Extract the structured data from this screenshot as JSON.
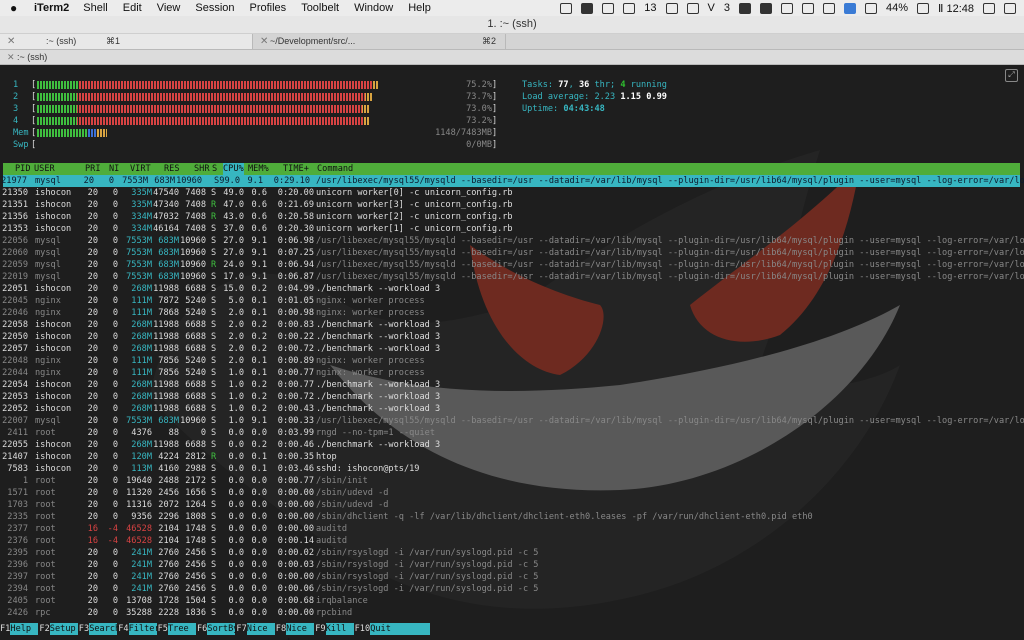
{
  "menubar": {
    "app": "iTerm2",
    "items": [
      "Shell",
      "Edit",
      "View",
      "Session",
      "Profiles",
      "Toolbelt",
      "Window",
      "Help"
    ],
    "status": {
      "badge": "13",
      "letter_v": "V",
      "number": "3",
      "battery": "44%",
      "clock": "Ⅱ 12:48"
    }
  },
  "window": {
    "title": "1. :~ (ssh)"
  },
  "tabs": [
    {
      "label": ":~ (ssh)",
      "shortcut": "⌘1"
    },
    {
      "label": "~/Development/src/...",
      "shortcut": "⌘2"
    }
  ],
  "subtab": {
    "label": ":~ (ssh)"
  },
  "meters": {
    "cpus": [
      {
        "id": "1",
        "pct": "75.2%",
        "fill": 0.752
      },
      {
        "id": "2",
        "pct": "73.7%",
        "fill": 0.737
      },
      {
        "id": "3",
        "pct": "73.0%",
        "fill": 0.73
      },
      {
        "id": "4",
        "pct": "73.2%",
        "fill": 0.732
      }
    ],
    "mem": {
      "label": "Mem",
      "value": "1148/7483MB",
      "fill": 0.153
    },
    "swp": {
      "label": "Swp",
      "value": "0/0MB",
      "fill": 0
    }
  },
  "info": {
    "tasks_label": "Tasks: ",
    "tasks": "77",
    "thr_sep": ", ",
    "thr": "36",
    "thr_label": " thr; ",
    "running": "4",
    "running_label": " running",
    "load_label": "Load average: ",
    "load1": "2.23",
    "load5": "1.15",
    "load15": "0.99",
    "uptime_label": "Uptime: ",
    "uptime": "04:43:48"
  },
  "columns": {
    "pid": "PID",
    "user": "USER",
    "pri": "PRI",
    "ni": "NI",
    "virt": "VIRT",
    "res": "RES",
    "shr": "SHR",
    "s": "S",
    "cpu": "CPU%",
    "mem": "MEM%",
    "time": "TIME+",
    "cmd": "Command"
  },
  "processes": [
    [
      "21977",
      "mysql",
      "20",
      "0",
      "7553M",
      "683M",
      "10960",
      "S",
      "99.0",
      "9.1",
      "0:29.10",
      "/usr/libexec/mysql55/mysqld --basedir=/usr --datadir=/var/lib/mysql --plugin-dir=/usr/lib64/mysql/plugin --user=mysql --log-error=/var/log/my"
    ],
    [
      "21350",
      "ishocon",
      "20",
      "0",
      "335M",
      "47540",
      "7408",
      "S",
      "49.0",
      "0.6",
      "0:20.00",
      "unicorn worker[0] -c unicorn_config.rb"
    ],
    [
      "21351",
      "ishocon",
      "20",
      "0",
      "335M",
      "47340",
      "7408",
      "R",
      "47.0",
      "0.6",
      "0:21.69",
      "unicorn worker[3] -c unicorn_config.rb"
    ],
    [
      "21356",
      "ishocon",
      "20",
      "0",
      "334M",
      "47032",
      "7408",
      "R",
      "43.0",
      "0.6",
      "0:20.58",
      "unicorn worker[2] -c unicorn_config.rb"
    ],
    [
      "21353",
      "ishocon",
      "20",
      "0",
      "334M",
      "46164",
      "7408",
      "S",
      "37.0",
      "0.6",
      "0:20.30",
      "unicorn worker[1] -c unicorn_config.rb"
    ],
    [
      "22056",
      "mysql",
      "20",
      "0",
      "7553M",
      "683M",
      "10960",
      "S",
      "27.0",
      "9.1",
      "0:06.98",
      "/usr/libexec/mysql55/mysqld --basedir=/usr --datadir=/var/lib/mysql --plugin-dir=/usr/lib64/mysql/plugin --user=mysql --log-error=/var/log/my"
    ],
    [
      "22060",
      "mysql",
      "20",
      "0",
      "7553M",
      "683M",
      "10960",
      "S",
      "27.0",
      "9.1",
      "0:07.25",
      "/usr/libexec/mysql55/mysqld --basedir=/usr --datadir=/var/lib/mysql --plugin-dir=/usr/lib64/mysql/plugin --user=mysql --log-error=/var/log/my"
    ],
    [
      "22059",
      "mysql",
      "20",
      "0",
      "7553M",
      "683M",
      "10960",
      "R",
      "24.0",
      "9.1",
      "0:06.94",
      "/usr/libexec/mysql55/mysqld --basedir=/usr --datadir=/var/lib/mysql --plugin-dir=/usr/lib64/mysql/plugin --user=mysql --log-error=/var/log/my"
    ],
    [
      "22019",
      "mysql",
      "20",
      "0",
      "7553M",
      "683M",
      "10960",
      "S",
      "17.0",
      "9.1",
      "0:06.87",
      "/usr/libexec/mysql55/mysqld --basedir=/usr --datadir=/var/lib/mysql --plugin-dir=/usr/lib64/mysql/plugin --user=mysql --log-error=/var/log/my"
    ],
    [
      "22051",
      "ishocon",
      "20",
      "0",
      "268M",
      "11988",
      "6688",
      "S",
      "15.0",
      "0.2",
      "0:04.99",
      "./benchmark --workload 3"
    ],
    [
      "22045",
      "nginx",
      "20",
      "0",
      "111M",
      "7872",
      "5240",
      "S",
      "5.0",
      "0.1",
      "0:01.05",
      "nginx: worker process"
    ],
    [
      "22046",
      "nginx",
      "20",
      "0",
      "111M",
      "7868",
      "5240",
      "S",
      "2.0",
      "0.1",
      "0:00.98",
      "nginx: worker process"
    ],
    [
      "22058",
      "ishocon",
      "20",
      "0",
      "268M",
      "11988",
      "6688",
      "S",
      "2.0",
      "0.2",
      "0:00.83",
      "./benchmark --workload 3"
    ],
    [
      "22050",
      "ishocon",
      "20",
      "0",
      "268M",
      "11988",
      "6688",
      "S",
      "2.0",
      "0.2",
      "0:00.22",
      "./benchmark --workload 3"
    ],
    [
      "22057",
      "ishocon",
      "20",
      "0",
      "268M",
      "11988",
      "6688",
      "S",
      "2.0",
      "0.2",
      "0:00.72",
      "./benchmark --workload 3"
    ],
    [
      "22048",
      "nginx",
      "20",
      "0",
      "111M",
      "7856",
      "5240",
      "S",
      "2.0",
      "0.1",
      "0:00.89",
      "nginx: worker process"
    ],
    [
      "22044",
      "nginx",
      "20",
      "0",
      "111M",
      "7856",
      "5240",
      "S",
      "1.0",
      "0.1",
      "0:00.77",
      "nginx: worker process"
    ],
    [
      "22054",
      "ishocon",
      "20",
      "0",
      "268M",
      "11988",
      "6688",
      "S",
      "1.0",
      "0.2",
      "0:00.77",
      "./benchmark --workload 3"
    ],
    [
      "22053",
      "ishocon",
      "20",
      "0",
      "268M",
      "11988",
      "6688",
      "S",
      "1.0",
      "0.2",
      "0:00.72",
      "./benchmark --workload 3"
    ],
    [
      "22052",
      "ishocon",
      "20",
      "0",
      "268M",
      "11988",
      "6688",
      "S",
      "1.0",
      "0.2",
      "0:00.43",
      "./benchmark --workload 3"
    ],
    [
      "22007",
      "mysql",
      "20",
      "0",
      "7553M",
      "683M",
      "10960",
      "S",
      "1.0",
      "9.1",
      "0:00.33",
      "/usr/libexec/mysql55/mysqld --basedir=/usr --datadir=/var/lib/mysql --plugin-dir=/usr/lib64/mysql/plugin --user=mysql --log-error=/var/log/my"
    ],
    [
      "2411",
      "root",
      "20",
      "0",
      "4376",
      "88",
      "0",
      "S",
      "0.0",
      "0.0",
      "0:03.99",
      "rngd --no-tpm=1 --quiet"
    ],
    [
      "22055",
      "ishocon",
      "20",
      "0",
      "268M",
      "11988",
      "6688",
      "S",
      "0.0",
      "0.2",
      "0:00.46",
      "./benchmark --workload 3"
    ],
    [
      "21407",
      "ishocon",
      "20",
      "0",
      "120M",
      "4224",
      "2812",
      "R",
      "0.0",
      "0.1",
      "0:00.35",
      "htop"
    ],
    [
      "7583",
      "ishocon",
      "20",
      "0",
      "113M",
      "4160",
      "2988",
      "S",
      "0.0",
      "0.1",
      "0:03.46",
      "sshd: ishocon@pts/19"
    ],
    [
      "1",
      "root",
      "20",
      "0",
      "19640",
      "2488",
      "2172",
      "S",
      "0.0",
      "0.0",
      "0:00.77",
      "/sbin/init"
    ],
    [
      "1571",
      "root",
      "20",
      "0",
      "11320",
      "2456",
      "1656",
      "S",
      "0.0",
      "0.0",
      "0:00.00",
      "/sbin/udevd -d"
    ],
    [
      "1703",
      "root",
      "20",
      "0",
      "11316",
      "2072",
      "1264",
      "S",
      "0.0",
      "0.0",
      "0:00.00",
      "/sbin/udevd -d"
    ],
    [
      "2335",
      "root",
      "20",
      "0",
      "9356",
      "2296",
      "1808",
      "S",
      "0.0",
      "0.0",
      "0:00.00",
      "/sbin/dhclient -q -lf /var/lib/dhclient/dhclient-eth0.leases -pf /var/run/dhclient-eth0.pid eth0"
    ],
    [
      "2377",
      "root",
      "16",
      "-4",
      "46528",
      "2104",
      "1748",
      "S",
      "0.0",
      "0.0",
      "0:00.00",
      "auditd"
    ],
    [
      "2376",
      "root",
      "16",
      "-4",
      "46528",
      "2104",
      "1748",
      "S",
      "0.0",
      "0.0",
      "0:00.14",
      "auditd"
    ],
    [
      "2395",
      "root",
      "20",
      "0",
      "241M",
      "2760",
      "2456",
      "S",
      "0.0",
      "0.0",
      "0:00.02",
      "/sbin/rsyslogd -i /var/run/syslogd.pid -c 5"
    ],
    [
      "2396",
      "root",
      "20",
      "0",
      "241M",
      "2760",
      "2456",
      "S",
      "0.0",
      "0.0",
      "0:00.03",
      "/sbin/rsyslogd -i /var/run/syslogd.pid -c 5"
    ],
    [
      "2397",
      "root",
      "20",
      "0",
      "241M",
      "2760",
      "2456",
      "S",
      "0.0",
      "0.0",
      "0:00.00",
      "/sbin/rsyslogd -i /var/run/syslogd.pid -c 5"
    ],
    [
      "2394",
      "root",
      "20",
      "0",
      "241M",
      "2760",
      "2456",
      "S",
      "0.0",
      "0.0",
      "0:00.06",
      "/sbin/rsyslogd -i /var/run/syslogd.pid -c 5"
    ],
    [
      "2405",
      "root",
      "20",
      "0",
      "13708",
      "1728",
      "1504",
      "S",
      "0.0",
      "0.0",
      "0:00.68",
      "irqbalance"
    ],
    [
      "2426",
      "rpc",
      "20",
      "0",
      "35288",
      "2228",
      "1836",
      "S",
      "0.0",
      "0.0",
      "0:00.00",
      "rpcbind"
    ]
  ],
  "fkeys": [
    {
      "k": "F1",
      "a": "Help"
    },
    {
      "k": "F2",
      "a": "Setup"
    },
    {
      "k": "F3",
      "a": "Search"
    },
    {
      "k": "F4",
      "a": "Filter"
    },
    {
      "k": "F5",
      "a": "Tree"
    },
    {
      "k": "F6",
      "a": "SortBy"
    },
    {
      "k": "F7",
      "a": "Nice -"
    },
    {
      "k": "F8",
      "a": "Nice +"
    },
    {
      "k": "F9",
      "a": "Kill"
    },
    {
      "k": "F10",
      "a": "Quit"
    }
  ],
  "colors": {
    "accent_cyan": "#37b6c1",
    "header_green": "#4fad3a",
    "cpu_low": "#3fbf3f",
    "cpu_high": "#d84343"
  }
}
